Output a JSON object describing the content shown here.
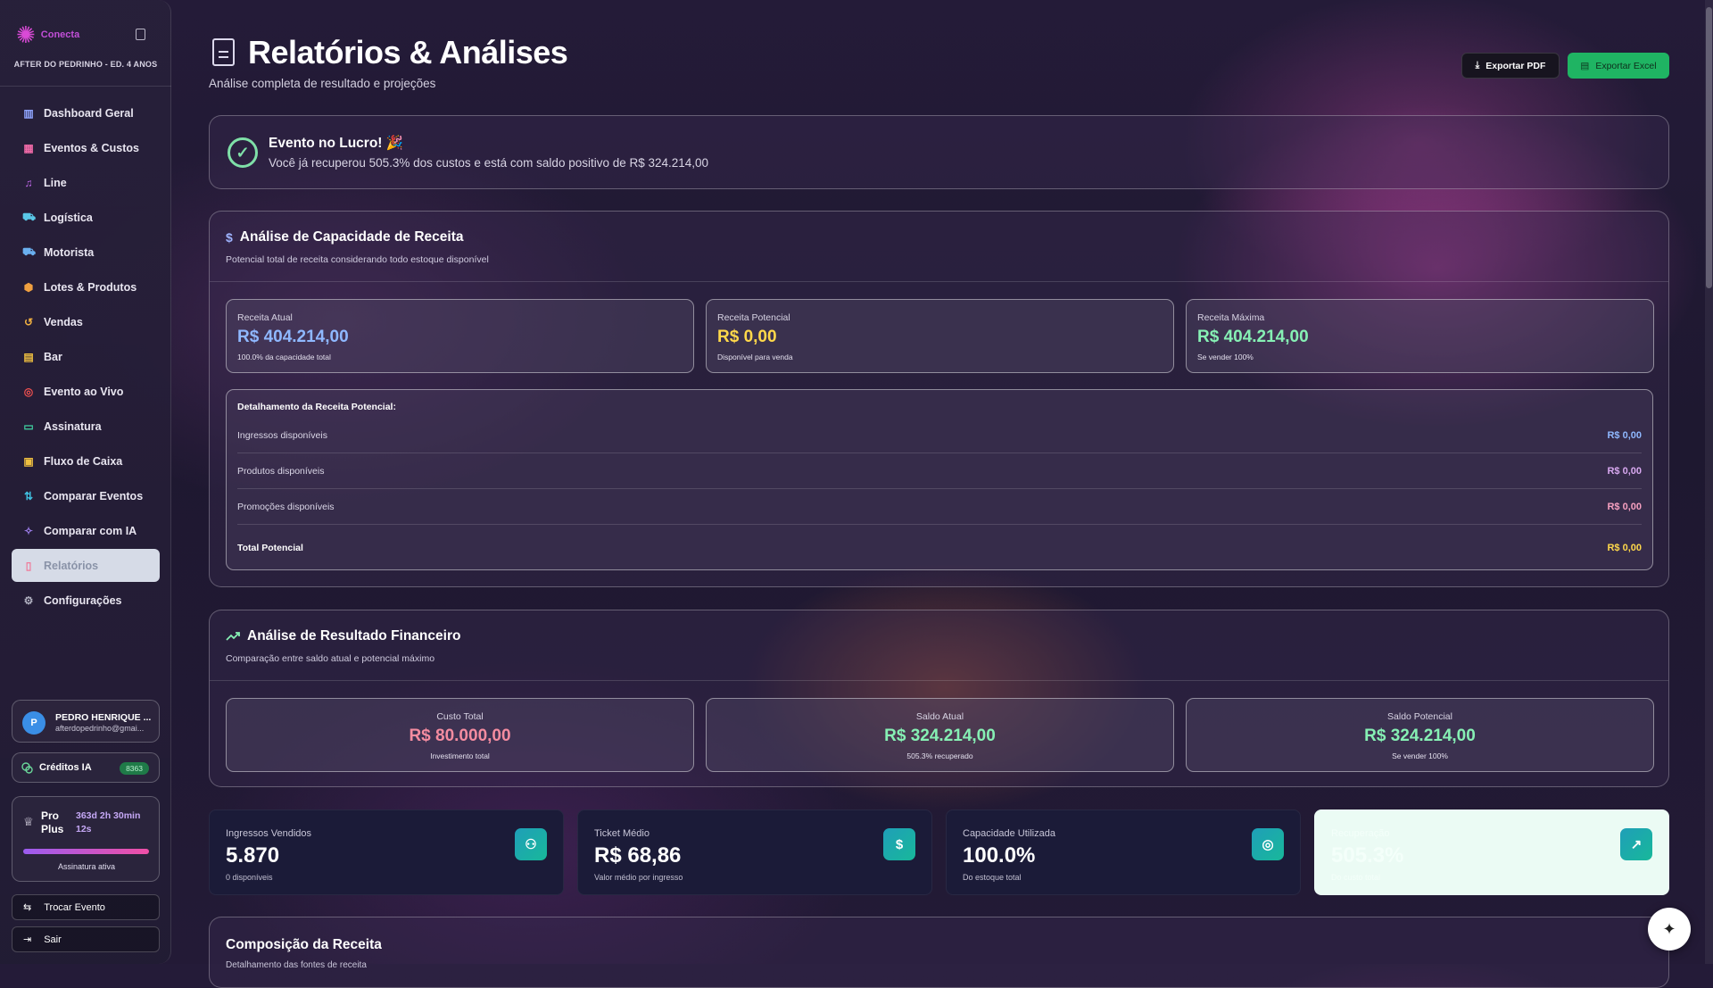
{
  "app": {
    "logo_text": "Conecta",
    "event_name": "AFTER DO PEDRINHO - ED. 4 ANOS"
  },
  "sidebar": {
    "items": [
      {
        "label": "Dashboard Geral",
        "icon": "bar-chart-icon",
        "color": "#8fa4ff"
      },
      {
        "label": "Eventos & Custos",
        "icon": "calendar-icon",
        "color": "#f06aa8"
      },
      {
        "label": "Line",
        "icon": "music-icon",
        "color": "#c56af0"
      },
      {
        "label": "Logística",
        "icon": "truck-icon",
        "color": "#5ac8e8"
      },
      {
        "label": "Motorista",
        "icon": "car-icon",
        "color": "#6ab0f0"
      },
      {
        "label": "Lotes & Produtos",
        "icon": "package-icon",
        "color": "#f0a040"
      },
      {
        "label": "Vendas",
        "icon": "history-icon",
        "color": "#f0b040"
      },
      {
        "label": "Bar",
        "icon": "beer-icon",
        "color": "#f0c040"
      },
      {
        "label": "Evento ao Vivo",
        "icon": "target-icon",
        "color": "#f05050"
      },
      {
        "label": "Assinatura",
        "icon": "card-icon",
        "color": "#40d0a0"
      },
      {
        "label": "Fluxo de Caixa",
        "icon": "wallet-icon",
        "color": "#f0c040"
      },
      {
        "label": "Comparar Eventos",
        "icon": "compare-icon",
        "color": "#40c0e0"
      },
      {
        "label": "Comparar com IA",
        "icon": "sparkles-icon",
        "color": "#a080f0"
      },
      {
        "label": "Relatórios",
        "icon": "file-icon",
        "color": "#f07a9a",
        "active": true
      },
      {
        "label": "Configurações",
        "icon": "gear-icon",
        "color": "#b0b0c0"
      }
    ],
    "user": {
      "initial": "P",
      "name": "PEDRO HENRIQUE ...",
      "email": "afterdopedrinho@gmai..."
    },
    "credits": {
      "label": "Créditos IA",
      "value": "8363"
    },
    "plan": {
      "name": "Pro Plus",
      "time_left": "363d 2h 30min 12s",
      "status": "Assinatura ativa",
      "progress": 1.0
    },
    "switch_label": "Trocar Evento",
    "logout_label": "Sair"
  },
  "header": {
    "title": "Relatórios & Análises",
    "subtitle": "Análise completa de resultado e projeções",
    "export_pdf": "Exportar PDF",
    "export_excel": "Exportar Excel"
  },
  "profit_banner": {
    "title": "Evento no Lucro! 🎉",
    "text": "Você já recuperou 505.3% dos custos e está com saldo positivo de R$ 324.214,00"
  },
  "capacity": {
    "title": "Análise de Capacidade de Receita",
    "subtitle": "Potencial total de receita considerando todo estoque disponível",
    "metrics": [
      {
        "label": "Receita Atual",
        "value": "R$ 404.214,00",
        "note": "100.0% da capacidade total",
        "color": "#8fb8ff"
      },
      {
        "label": "Receita Potencial",
        "value": "R$ 0,00",
        "note": "Disponível para venda",
        "color": "#ffd84a"
      },
      {
        "label": "Receita Máxima",
        "value": "R$ 404.214,00",
        "note": "Se vender 100%",
        "color": "#86f0b4"
      }
    ],
    "detail_title": "Detalhamento da Receita Potencial:",
    "detail_rows": [
      {
        "label": "Ingressos disponíveis",
        "value": "R$ 0,00",
        "color": "#8fb8ff"
      },
      {
        "label": "Produtos disponíveis",
        "value": "R$ 0,00",
        "color": "#d8a8f0"
      },
      {
        "label": "Promoções disponíveis",
        "value": "R$ 0,00",
        "color": "#f6a0c0"
      }
    ],
    "total_label": "Total Potencial",
    "total_value": "R$ 0,00",
    "total_color": "#ffd84a"
  },
  "financial": {
    "title": "Análise de Resultado Financeiro",
    "subtitle": "Comparação entre saldo atual e potencial máximo",
    "metrics": [
      {
        "label": "Custo Total",
        "value": "R$ 80.000,00",
        "note": "Investimento total",
        "color": "#f48ca0"
      },
      {
        "label": "Saldo Atual",
        "value": "R$ 324.214,00",
        "note": "505.3% recuperado",
        "color": "#86f0b4"
      },
      {
        "label": "Saldo Potencial",
        "value": "R$ 324.214,00",
        "note": "Se vender 100%",
        "color": "#86f0b4"
      }
    ]
  },
  "stats": [
    {
      "label": "Ingressos Vendidos",
      "value": "5.870",
      "note": "0 disponíveis",
      "icon": "users-icon"
    },
    {
      "label": "Ticket Médio",
      "value": "R$ 68,86",
      "note": "Valor médio por ingresso",
      "icon": "dollar-icon"
    },
    {
      "label": "Capacidade Utilizada",
      "value": "100.0%",
      "note": "Do estoque total",
      "icon": "target-icon"
    },
    {
      "label": "Recuperação",
      "value": "505.3%",
      "note": "Do custo total",
      "icon": "trending-up-icon"
    }
  ],
  "composition": {
    "title": "Composição da Receita",
    "subtitle": "Detalhamento das fontes de receita"
  }
}
